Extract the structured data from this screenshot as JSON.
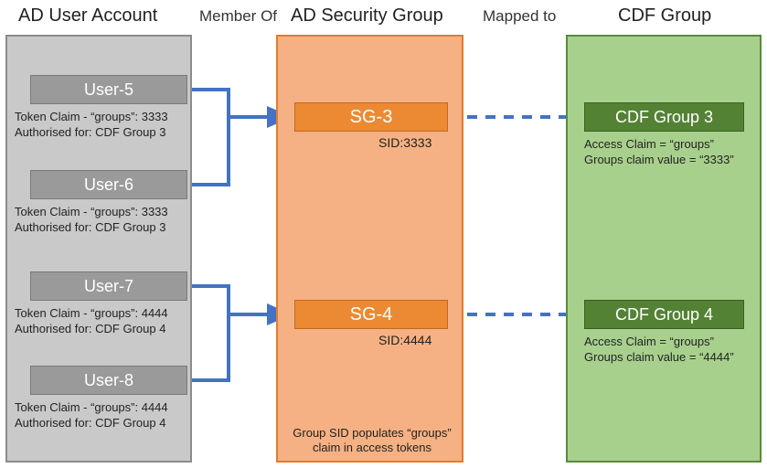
{
  "headers": {
    "col1": "AD User Account",
    "col2": "AD Security Group",
    "col3": "CDF Group",
    "between12": "Member Of",
    "between23": "Mapped to"
  },
  "users": [
    {
      "name": "User-5",
      "token_line": "Token Claim - “groups”: 3333",
      "auth_line": "Authorised for: CDF Group 3"
    },
    {
      "name": "User-6",
      "token_line": "Token Claim - “groups”: 3333",
      "auth_line": "Authorised for: CDF Group 3"
    },
    {
      "name": "User-7",
      "token_line": "Token Claim - “groups”: 4444",
      "auth_line": "Authorised for: CDF Group 4"
    },
    {
      "name": "User-8",
      "token_line": "Token Claim - “groups”: 4444",
      "auth_line": "Authorised for: CDF Group 4"
    }
  ],
  "security_groups": [
    {
      "name": "SG-3",
      "sid": "SID:3333"
    },
    {
      "name": "SG-4",
      "sid": "SID:4444"
    }
  ],
  "cdf_groups": [
    {
      "name": "CDF Group 3",
      "access_line": "Access Claim = “groups”",
      "value_line": "Groups claim value = “3333”"
    },
    {
      "name": "CDF Group 4",
      "access_line": "Access Claim = “groups”",
      "value_line": "Groups claim value = “4444”"
    }
  ],
  "footer_orange": "Group SID populates “groups” claim in access tokens"
}
